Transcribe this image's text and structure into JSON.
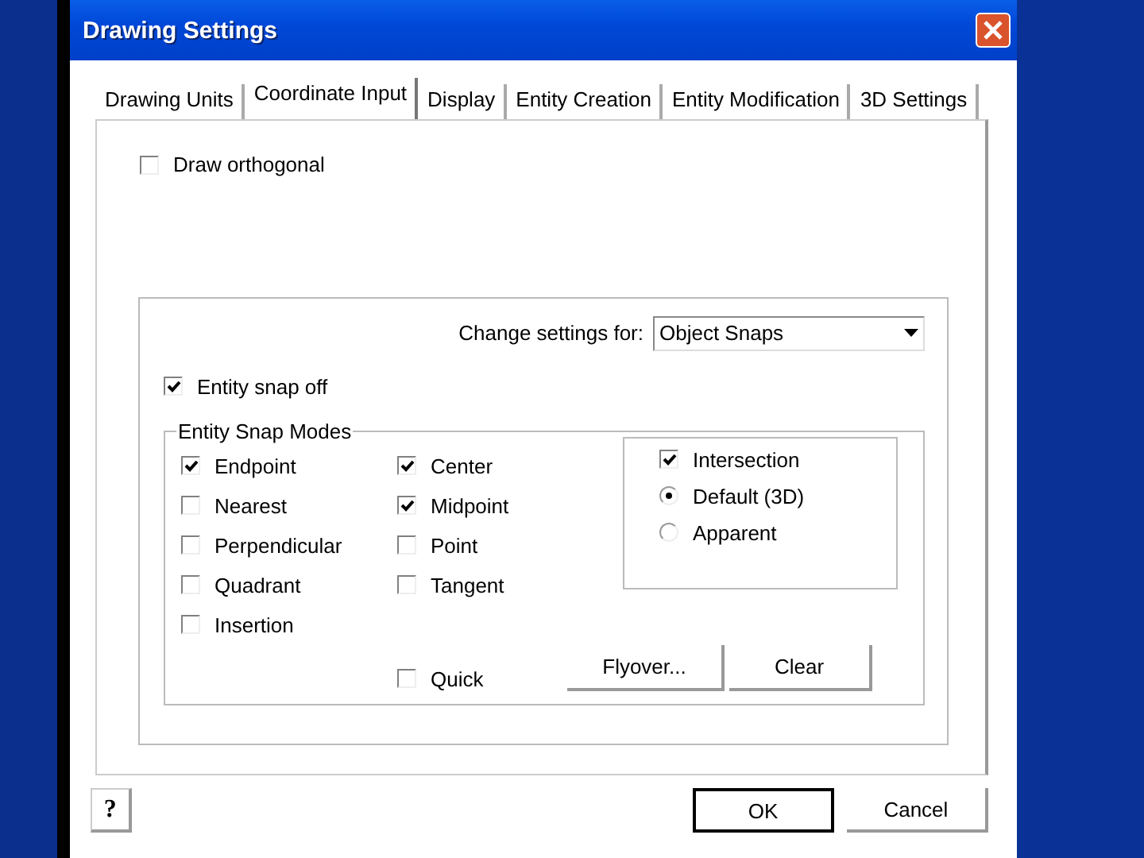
{
  "window": {
    "title": "Drawing Settings"
  },
  "tabs": [
    {
      "label": "Drawing Units",
      "selected": false
    },
    {
      "label": "Coordinate Input",
      "selected": true
    },
    {
      "label": "Display",
      "selected": false
    },
    {
      "label": "Entity Creation",
      "selected": false
    },
    {
      "label": "Entity Modification",
      "selected": false
    },
    {
      "label": "3D Settings",
      "selected": false
    }
  ],
  "draw_orthogonal": {
    "label": "Draw orthogonal",
    "checked": false
  },
  "change_settings": {
    "label": "Change settings for:",
    "value": "Object Snaps"
  },
  "entity_snap_off": {
    "label": "Entity snap off",
    "checked": true
  },
  "snap_modes": {
    "title": "Entity Snap Modes",
    "column_1": [
      {
        "label": "Endpoint",
        "checked": true
      },
      {
        "label": "Nearest",
        "checked": false
      },
      {
        "label": "Perpendicular",
        "checked": false
      },
      {
        "label": "Quadrant",
        "checked": false
      },
      {
        "label": "Insertion",
        "checked": false
      }
    ],
    "column_2": [
      {
        "label": "Center",
        "checked": true
      },
      {
        "label": "Midpoint",
        "checked": true
      },
      {
        "label": "Point",
        "checked": false
      },
      {
        "label": "Tangent",
        "checked": false
      }
    ],
    "intersection": {
      "label": "Intersection",
      "checked": true,
      "options": [
        {
          "label": "Default (3D)",
          "selected": true
        },
        {
          "label": "Apparent",
          "selected": false
        }
      ]
    },
    "quick": {
      "label": "Quick",
      "checked": false
    },
    "buttons": [
      "Flyover...",
      "Clear"
    ]
  },
  "help_button": "?",
  "buttons": [
    {
      "label": "OK",
      "default": true
    },
    {
      "label": "Cancel",
      "default": false
    }
  ]
}
